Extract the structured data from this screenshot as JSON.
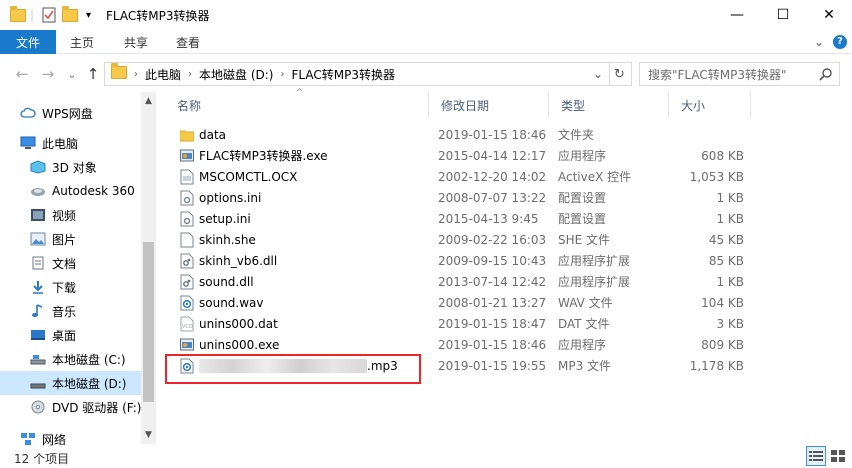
{
  "window": {
    "title": "FLAC转MP3转换器",
    "minimize": "—",
    "maximize": "☐",
    "close": "✕",
    "qa_dropdown": "▾"
  },
  "ribbon": {
    "file_tab": "文件",
    "tabs": [
      "主页",
      "共享",
      "查看"
    ],
    "expand": "⌄",
    "help": "?"
  },
  "address": {
    "back": "←",
    "forward": "→",
    "recent": "⌄",
    "up": "↑",
    "crumbs": [
      "此电脑",
      "本地磁盘 (D:)",
      "FLAC转MP3转换器"
    ],
    "separator": "›",
    "dropdown": "⌄",
    "refresh": "↻",
    "search_placeholder": "搜索\"FLAC转MP3转换器\""
  },
  "navpane": {
    "items": [
      {
        "label": "WPS网盘",
        "icon": "cloud-icon"
      },
      {
        "label": "此电脑",
        "icon": "computer-icon"
      },
      {
        "label": "3D 对象",
        "icon": "cube-icon"
      },
      {
        "label": "Autodesk 360",
        "icon": "autodesk-icon"
      },
      {
        "label": "视频",
        "icon": "video-icon"
      },
      {
        "label": "图片",
        "icon": "pictures-icon"
      },
      {
        "label": "文档",
        "icon": "documents-icon"
      },
      {
        "label": "下载",
        "icon": "download-icon"
      },
      {
        "label": "音乐",
        "icon": "music-icon"
      },
      {
        "label": "桌面",
        "icon": "desktop-icon"
      },
      {
        "label": "本地磁盘 (C:)",
        "icon": "drive-icon"
      },
      {
        "label": "本地磁盘 (D:)",
        "icon": "drive-icon"
      },
      {
        "label": "DVD 驱动器 (F:)",
        "icon": "dvd-icon"
      },
      {
        "label": "网络",
        "icon": "network-icon"
      }
    ],
    "scroll_up": "▲",
    "scroll_down": "▼"
  },
  "columns": {
    "name": "名称",
    "date": "修改日期",
    "type": "类型",
    "size": "大小",
    "sort_indicator": "^"
  },
  "files": [
    {
      "name": "data",
      "date": "2019-01-15 18:46",
      "type": "文件夹",
      "size": "",
      "icon": "folder-icon"
    },
    {
      "name": "FLAC转MP3转换器.exe",
      "date": "2015-04-14 12:17",
      "type": "应用程序",
      "size": "608 KB",
      "icon": "app-icon"
    },
    {
      "name": "MSCOMCTL.OCX",
      "date": "2002-12-20 14:02",
      "type": "ActiveX 控件",
      "size": "1,053 KB",
      "icon": "file-icon"
    },
    {
      "name": "options.ini",
      "date": "2008-07-07 13:22",
      "type": "配置设置",
      "size": "1 KB",
      "icon": "settings-file-icon"
    },
    {
      "name": "setup.ini",
      "date": "2015-04-13 9:45",
      "type": "配置设置",
      "size": "1 KB",
      "icon": "settings-file-icon"
    },
    {
      "name": "skinh.she",
      "date": "2009-02-22 16:03",
      "type": "SHE 文件",
      "size": "45 KB",
      "icon": "blank-file-icon"
    },
    {
      "name": "skinh_vb6.dll",
      "date": "2009-09-15 10:43",
      "type": "应用程序扩展",
      "size": "85 KB",
      "icon": "dll-icon"
    },
    {
      "name": "sound.dll",
      "date": "2013-07-14 12:42",
      "type": "应用程序扩展",
      "size": "1 KB",
      "icon": "dll-icon"
    },
    {
      "name": "sound.wav",
      "date": "2008-01-21 13:27",
      "type": "WAV 文件",
      "size": "104 KB",
      "icon": "audio-file-icon"
    },
    {
      "name": "unins000.dat",
      "date": "2019-01-15 18:47",
      "type": "DAT 文件",
      "size": "3 KB",
      "icon": "dat-file-icon"
    },
    {
      "name": "unins000.exe",
      "date": "2019-01-15 18:46",
      "type": "应用程序",
      "size": "809 KB",
      "icon": "app-icon"
    },
    {
      "name": ".mp3",
      "date": "2019-01-15 19:55",
      "type": "MP3 文件",
      "size": "1,178 KB",
      "icon": "audio-file-icon",
      "blurred": true
    }
  ],
  "status": {
    "count": "12 个项目"
  },
  "colors": {
    "accent": "#1979ca",
    "selection": "#cce8ff",
    "highlight_box": "#e8262b",
    "folder": "#f7c948"
  }
}
